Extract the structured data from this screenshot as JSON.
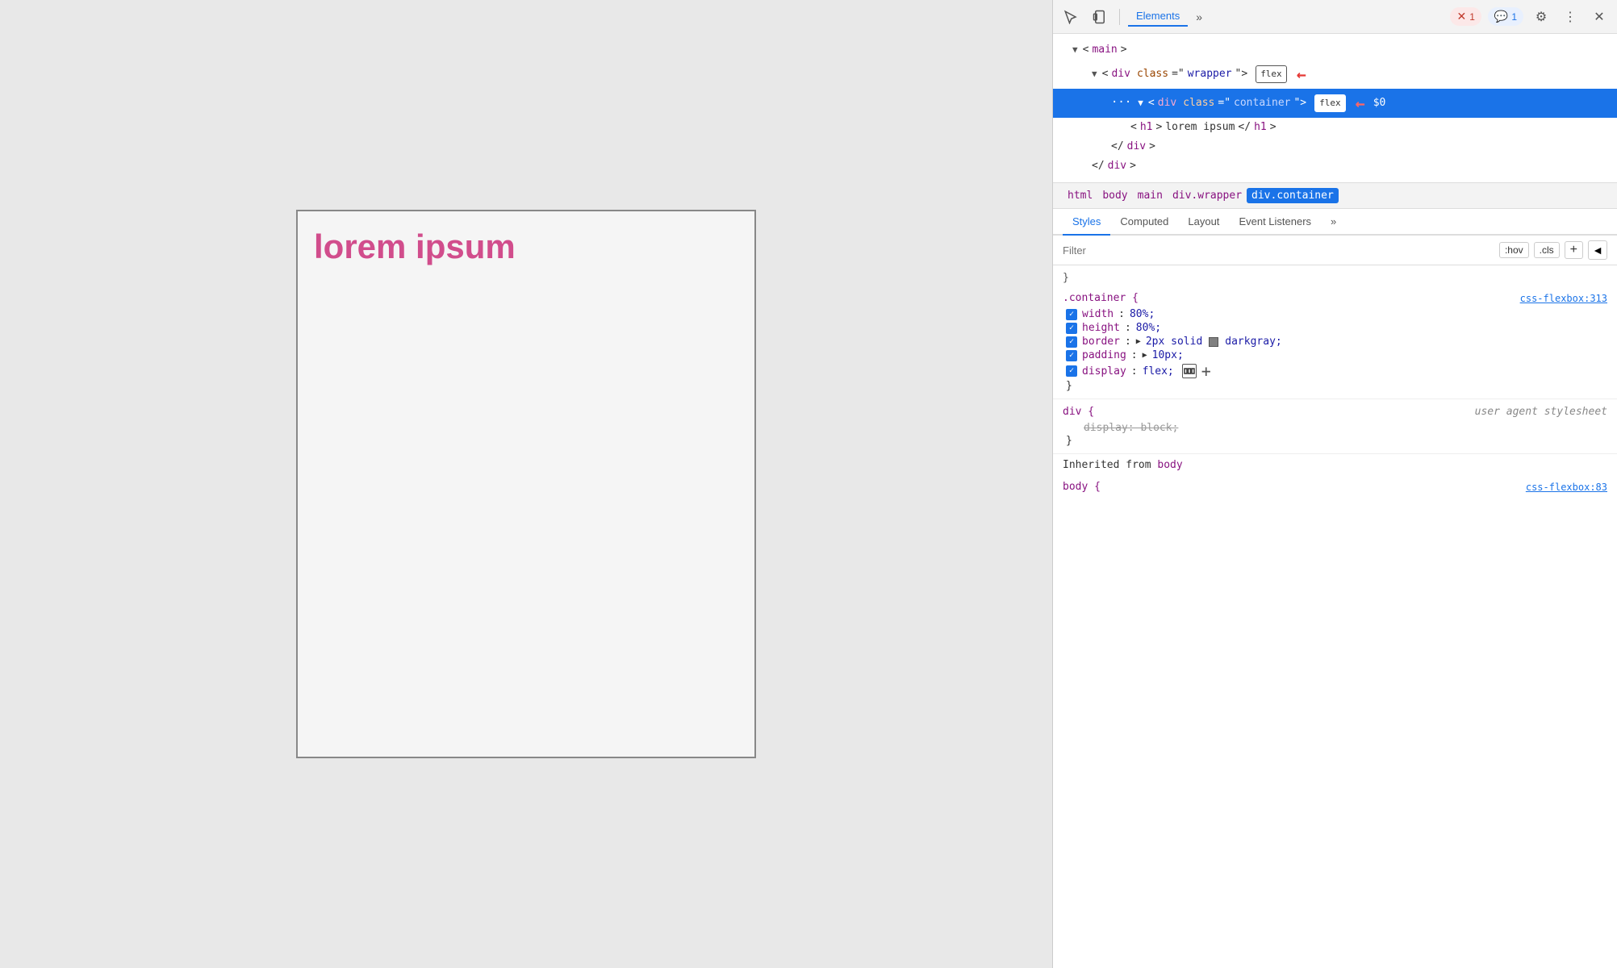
{
  "viewport": {
    "lorem_ipsum": "lorem ipsum"
  },
  "devtools": {
    "toolbar": {
      "inspect_label": "⬡",
      "device_label": "▭",
      "elements_tab": "Elements",
      "more_label": "»",
      "error_count": "1",
      "console_count": "1",
      "gear_label": "⚙",
      "more_vert_label": "⋮",
      "close_label": "✕"
    },
    "dom_tree": {
      "lines": [
        {
          "indent": 1,
          "html": "<main>"
        },
        {
          "indent": 2,
          "html": "<div class=\"wrapper\">",
          "badge": "flex",
          "arrow": true
        },
        {
          "indent": 3,
          "html": "<div class=\"container\">",
          "badge": "flex",
          "arrow": true,
          "selected": true,
          "dots": true
        },
        {
          "indent": 4,
          "html": "<h1>lorem ipsum</h1>"
        },
        {
          "indent": 3,
          "html": "</div>"
        },
        {
          "indent": 2,
          "html": "</div>"
        }
      ]
    },
    "breadcrumbs": [
      "html",
      "body",
      "main",
      "div.wrapper",
      "div.container"
    ],
    "sub_tabs": [
      "Styles",
      "Computed",
      "Layout",
      "Event Listeners",
      "»"
    ],
    "filter": {
      "placeholder": "Filter",
      "hov_btn": ":hov",
      "cls_btn": ".cls",
      "add_btn": "+",
      "toggle_btn": "◄"
    },
    "styles": {
      "container_rule": {
        "selector": ".container {",
        "source": "css-flexbox:313",
        "properties": [
          {
            "checked": true,
            "name": "width",
            "value": "80%;"
          },
          {
            "checked": true,
            "name": "height",
            "value": "80%;"
          },
          {
            "checked": true,
            "name": "border",
            "value": "2px solid",
            "has_swatch": true,
            "swatch_color": "#808080",
            "extra": "darkgray;"
          },
          {
            "checked": true,
            "name": "padding",
            "value": "10px;",
            "has_triangle": true
          },
          {
            "checked": true,
            "name": "display",
            "value": "flex;",
            "has_flex_icon": true
          }
        ],
        "close": "}"
      },
      "div_rule": {
        "selector": "div {",
        "source": "user agent stylesheet",
        "properties": [
          {
            "strikethrough": true,
            "name": "display",
            "value": "block;"
          }
        ],
        "close": "}"
      },
      "inherited_label": "Inherited from",
      "inherited_element": "body",
      "body_source": "css-flexbox:83"
    }
  }
}
